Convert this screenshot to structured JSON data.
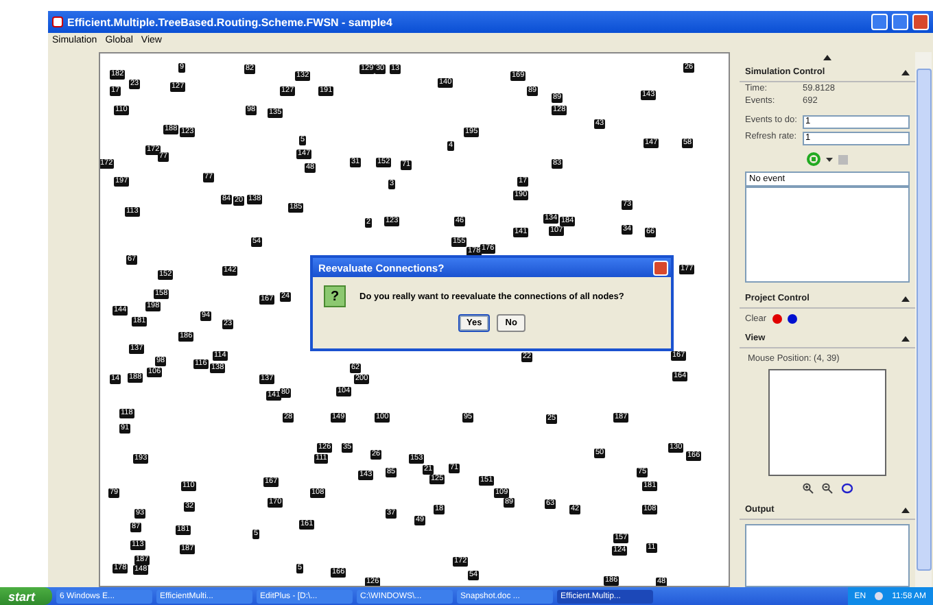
{
  "window": {
    "title": "Efficient.Multiple.TreeBased.Routing.Scheme.FWSN - sample4"
  },
  "menu": [
    "Simulation",
    "Global",
    "View"
  ],
  "canvas": {
    "nodes": [
      "182",
      "17",
      "23",
      "127",
      "9",
      "82",
      "132",
      "127",
      "98",
      "135",
      "129",
      "30",
      "13",
      "191",
      "140",
      "169",
      "89",
      "143",
      "26",
      "110",
      "188",
      "123",
      "172",
      "77",
      "172",
      "197",
      "113",
      "77",
      "84",
      "20",
      "138",
      "54",
      "185",
      "147",
      "48",
      "5",
      "31",
      "152",
      "3",
      "2",
      "123",
      "71",
      "195",
      "4",
      "89",
      "128",
      "43",
      "147",
      "58",
      "83",
      "17",
      "190",
      "134",
      "184",
      "107",
      "73",
      "34",
      "141",
      "66",
      "46",
      "155",
      "178",
      "176",
      "67",
      "152",
      "142",
      "158",
      "144",
      "198",
      "181",
      "94",
      "23",
      "167",
      "24",
      "137",
      "186",
      "98",
      "106",
      "116",
      "138",
      "114",
      "14",
      "188",
      "137",
      "141",
      "80",
      "62",
      "200",
      "104",
      "118",
      "91",
      "28",
      "149",
      "100",
      "95",
      "25",
      "187",
      "22",
      "167",
      "164",
      "177",
      "193",
      "126",
      "35",
      "111",
      "26",
      "153",
      "21",
      "71",
      "143",
      "85",
      "125",
      "151",
      "109",
      "50",
      "130",
      "166",
      "75",
      "181",
      "79",
      "110",
      "167",
      "170",
      "108",
      "32",
      "93",
      "87",
      "181",
      "5",
      "161",
      "37",
      "49",
      "18",
      "89",
      "63",
      "42",
      "108",
      "157",
      "124",
      "11",
      "113",
      "187",
      "187",
      "178",
      "148",
      "5",
      "166",
      "126",
      "172",
      "54",
      "186",
      "48"
    ]
  },
  "dialog": {
    "title": "Reevaluate Connections?",
    "icon": "?",
    "message": "Do you really want to reevaluate the connections of all nodes?",
    "buttons": [
      {
        "label": "Yes",
        "default": true
      },
      {
        "label": "No",
        "default": false
      }
    ]
  },
  "simulation_control": {
    "title": "Simulation Control",
    "stats": [
      {
        "label": "Time:",
        "value": "59.8128"
      },
      {
        "label": "Events:",
        "value": "692"
      }
    ],
    "fields": [
      {
        "label": "Events to do:",
        "value": "1"
      },
      {
        "label": "Refresh rate:",
        "value": "1"
      }
    ],
    "stop_disabled": true,
    "event_field": "No event"
  },
  "project_control": {
    "title": "Project Control",
    "label": "Clear",
    "dots": [
      {
        "color": "#e00000"
      },
      {
        "color": "#0010d0"
      }
    ]
  },
  "view": {
    "title": "View",
    "mouse_position": "Mouse Position:  (4, 39)"
  },
  "output": {
    "title": "Output"
  },
  "taskbar": {
    "start": "start",
    "items": [
      {
        "label": "6 Windows E...",
        "selected": false
      },
      {
        "label": "EfficientMulti...",
        "selected": false
      },
      {
        "label": "EditPlus - [D:\\...",
        "selected": false
      },
      {
        "label": "C:\\WINDOWS\\...",
        "selected": false
      },
      {
        "label": "Snapshot.doc ...",
        "selected": false
      },
      {
        "label": "Efficient.Multip...",
        "selected": true
      }
    ],
    "language": "EN",
    "time": "11:58 AM"
  }
}
